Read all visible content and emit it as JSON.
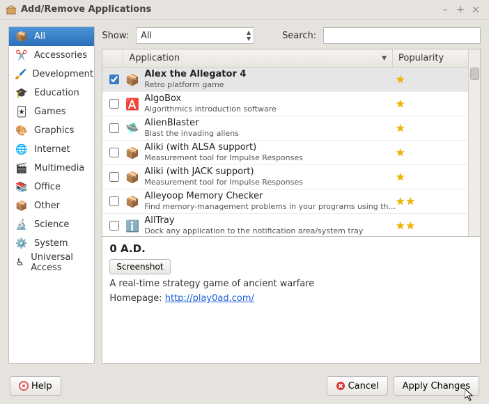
{
  "window": {
    "title": "Add/Remove Applications"
  },
  "toolbar": {
    "show_label": "Show:",
    "show_value": "All",
    "search_label": "Search:",
    "search_value": ""
  },
  "sidebar": {
    "items": [
      {
        "label": "All",
        "icon": "📦",
        "selected": true
      },
      {
        "label": "Accessories",
        "icon": "✂️"
      },
      {
        "label": "Development",
        "icon": "🖌️"
      },
      {
        "label": "Education",
        "icon": "🎓"
      },
      {
        "label": "Games",
        "icon": "🃏"
      },
      {
        "label": "Graphics",
        "icon": "🎨"
      },
      {
        "label": "Internet",
        "icon": "🌐"
      },
      {
        "label": "Multimedia",
        "icon": "🎬"
      },
      {
        "label": "Office",
        "icon": "📚"
      },
      {
        "label": "Other",
        "icon": "📦"
      },
      {
        "label": "Science",
        "icon": "🔬"
      },
      {
        "label": "System",
        "icon": "⚙️"
      },
      {
        "label": "Universal Access",
        "icon": "♿"
      }
    ]
  },
  "list": {
    "header": {
      "app": "Application",
      "pop": "Popularity"
    },
    "rows": [
      {
        "checked": true,
        "selected": true,
        "icon": "📦",
        "name": "Alex the Allegator 4",
        "desc": "Retro platform game",
        "stars": 1
      },
      {
        "checked": false,
        "icon": "🅰️",
        "name": "AlgoBox",
        "desc": "Algorithmics introduction software",
        "stars": 1
      },
      {
        "checked": false,
        "icon": "🛸",
        "name": "AlienBlaster",
        "desc": "Blast the invading aliens",
        "stars": 1
      },
      {
        "checked": false,
        "icon": "📦",
        "name": "Aliki (with ALSA support)",
        "desc": "Measurement tool for Impulse Responses",
        "stars": 1
      },
      {
        "checked": false,
        "icon": "📦",
        "name": "Aliki (with JACK support)",
        "desc": "Measurement tool for Impulse Responses",
        "stars": 1
      },
      {
        "checked": false,
        "icon": "📦",
        "name": "Alleyoop Memory Checker",
        "desc": "Find memory-management problems in your programs using th...",
        "stars": 2
      },
      {
        "checked": false,
        "icon": "ℹ️",
        "name": "AllTray",
        "desc": "Dock any application to the notification area/system tray",
        "stars": 2
      }
    ]
  },
  "detail": {
    "title": "0 A.D.",
    "screenshot_btn": "Screenshot",
    "description": "A real-time strategy game of ancient warfare",
    "homepage_label": "Homepage: ",
    "homepage_url": "http://play0ad.com/"
  },
  "footer": {
    "help": "Help",
    "cancel": "Cancel",
    "apply": "Apply Changes"
  }
}
